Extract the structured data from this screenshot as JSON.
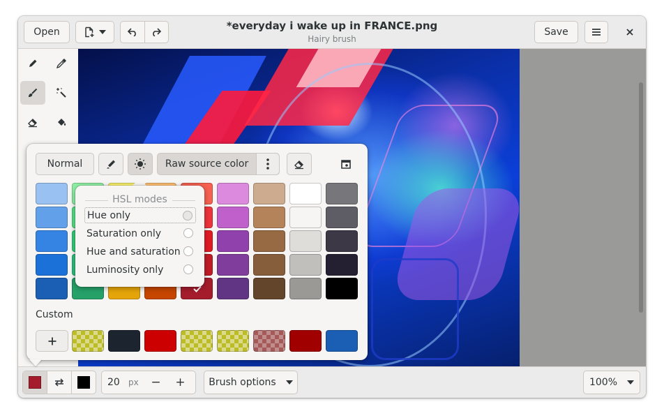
{
  "window": {
    "title": "*everyday i wake up in FRANCE.png",
    "subtitle": "Hairy brush"
  },
  "header": {
    "open_label": "Open",
    "new_icon": "new-document-icon",
    "undo_icon": "undo-icon",
    "redo_icon": "redo-icon",
    "save_label": "Save",
    "menu_icon": "hamburger-menu-icon",
    "close_icon": "close-icon"
  },
  "tools": [
    {
      "name": "pencil",
      "icon": "pencil-icon",
      "active": false
    },
    {
      "name": "color-picker",
      "icon": "eyedropper-icon",
      "active": false
    },
    {
      "name": "hairy-brush",
      "icon": "brush-icon",
      "active": true
    },
    {
      "name": "magic-wand",
      "icon": "wand-icon",
      "active": false
    },
    {
      "name": "eraser",
      "icon": "eraser-icon",
      "active": false
    },
    {
      "name": "paint-bucket",
      "icon": "bucket-icon",
      "active": false
    }
  ],
  "popover": {
    "mode_label": "Normal",
    "source_label": "Raw source color",
    "palette": [
      [
        "#99c1f1",
        "#8ff0a4",
        "#f9f06b",
        "#ffbe6f",
        "#f66151",
        "#dc8add",
        "#cdab8f",
        "#ffffff",
        "#77767b"
      ],
      [
        "#62a0ea",
        "#57e389",
        "#f8e45c",
        "#ffa348",
        "#ed333b",
        "#c061cb",
        "#b5835a",
        "#f6f5f4",
        "#5e5c64"
      ],
      [
        "#3584e4",
        "#33d17a",
        "#f6d32d",
        "#ff7800",
        "#e01b24",
        "#9141ac",
        "#986a44",
        "#deddda",
        "#3d3846"
      ],
      [
        "#1c71d8",
        "#2ec27e",
        "#f5c211",
        "#e66100",
        "#c01c28",
        "#813d9c",
        "#865e3c",
        "#c0bfbc",
        "#241f31"
      ],
      [
        "#1a5fb4",
        "#26a269",
        "#e5a50a",
        "#c64600",
        "#a51d2d",
        "#613583",
        "#63452c",
        "#9a9996",
        "#000000"
      ]
    ],
    "selected_swatch": "#a51d2d",
    "custom_label": "Custom",
    "custom_add_icon": "plus-icon",
    "custom": [
      "checker-yellow",
      "#1c2430",
      "#cc0000",
      "checker-yellow",
      "checker-yellow",
      "checker-red",
      "#a00000",
      "#1a5fb4"
    ]
  },
  "hsl": {
    "title": "HSL modes",
    "items": [
      {
        "label": "Hue only",
        "focused": true
      },
      {
        "label": "Saturation only",
        "focused": false
      },
      {
        "label": "Hue and saturation",
        "focused": false
      },
      {
        "label": "Luminosity only",
        "focused": false
      }
    ]
  },
  "bottom": {
    "main_color": "#a51d2d",
    "secondary_color": "#000000",
    "size_value": "20",
    "size_unit": "px",
    "minus_label": "−",
    "plus_label": "+",
    "brush_options_label": "Brush options",
    "zoom_label": "100%"
  }
}
